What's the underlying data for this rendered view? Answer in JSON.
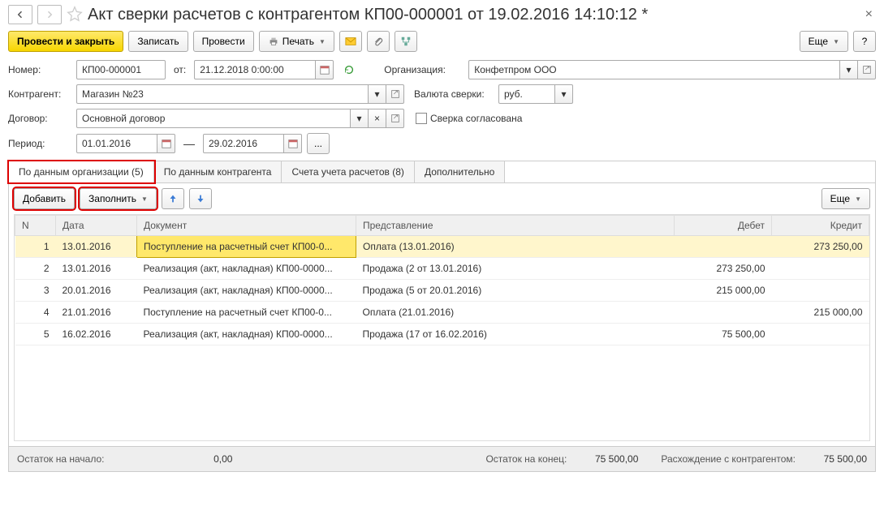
{
  "title": "Акт сверки расчетов с контрагентом КП00-000001 от 19.02.2016 14:10:12 *",
  "toolbar": {
    "post_close": "Провести и закрыть",
    "write": "Записать",
    "post": "Провести",
    "print": "Печать",
    "more": "Еще"
  },
  "form": {
    "number_label": "Номер:",
    "number": "КП00-000001",
    "from_label": "от:",
    "date": "21.12.2018  0:00:00",
    "org_label": "Организация:",
    "org": "Конфетпром ООО",
    "partner_label": "Контрагент:",
    "partner": "Магазин №23",
    "currency_label": "Валюта сверки:",
    "currency": "руб.",
    "contract_label": "Договор:",
    "contract": "Основной договор",
    "agreed_label": "Сверка согласована",
    "period_label": "Период:",
    "period_from": "01.01.2016",
    "period_to": "29.02.2016"
  },
  "tabs": {
    "org": "По данным организации (5)",
    "partner": "По данным контрагента",
    "accounts": "Счета учета расчетов (8)",
    "extra": "Дополнительно"
  },
  "panel": {
    "add": "Добавить",
    "fill": "Заполнить",
    "more": "Еще"
  },
  "columns": {
    "n": "N",
    "date": "Дата",
    "doc": "Документ",
    "repr": "Представление",
    "debit": "Дебет",
    "credit": "Кредит"
  },
  "rows": [
    {
      "n": "1",
      "date": "13.01.2016",
      "doc": "Поступление на расчетный счет КП00-0...",
      "repr": "Оплата (13.01.2016)",
      "debit": "",
      "credit": "273 250,00"
    },
    {
      "n": "2",
      "date": "13.01.2016",
      "doc": "Реализация (акт, накладная) КП00-0000...",
      "repr": "Продажа (2 от 13.01.2016)",
      "debit": "273 250,00",
      "credit": ""
    },
    {
      "n": "3",
      "date": "20.01.2016",
      "doc": "Реализация (акт, накладная) КП00-0000...",
      "repr": "Продажа (5 от 20.01.2016)",
      "debit": "215 000,00",
      "credit": ""
    },
    {
      "n": "4",
      "date": "21.01.2016",
      "doc": "Поступление на расчетный счет КП00-0...",
      "repr": "Оплата (21.01.2016)",
      "debit": "",
      "credit": "215 000,00"
    },
    {
      "n": "5",
      "date": "16.02.2016",
      "doc": "Реализация (акт, накладная) КП00-0000...",
      "repr": "Продажа (17 от 16.02.2016)",
      "debit": "75 500,00",
      "credit": ""
    }
  ],
  "footer": {
    "start_label": "Остаток на начало:",
    "start": "0,00",
    "end_label": "Остаток на конец:",
    "end": "75 500,00",
    "diff_label": "Расхождение с контрагентом:",
    "diff": "75 500,00"
  }
}
